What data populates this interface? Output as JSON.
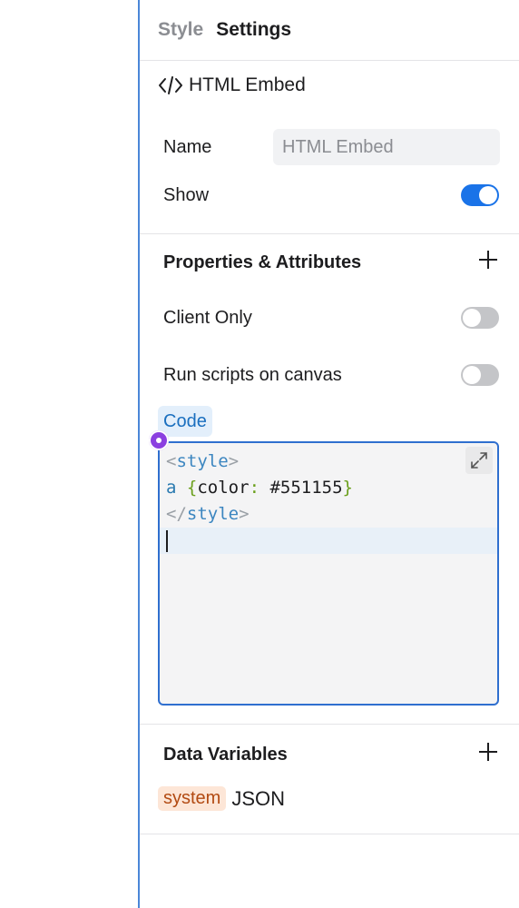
{
  "tabs": {
    "style": "Style",
    "settings": "Settings"
  },
  "component": {
    "icon": "code-icon",
    "title": "HTML Embed"
  },
  "name_field": {
    "label": "Name",
    "placeholder": "HTML Embed"
  },
  "show": {
    "label": "Show",
    "value": true
  },
  "properties": {
    "title": "Properties & Attributes",
    "add_icon": "plus-icon"
  },
  "client_only": {
    "label": "Client Only",
    "value": false
  },
  "run_scripts": {
    "label": "Run scripts on canvas",
    "value": false
  },
  "code": {
    "label": "Code",
    "lines": [
      "<style>",
      "a {color: #551155}",
      "</style>",
      ""
    ],
    "expand_icon": "expand-icon"
  },
  "data_variables": {
    "title": "Data Variables",
    "add_icon": "plus-icon",
    "items": [
      {
        "badge": "system",
        "name": "JSON"
      }
    ]
  },
  "colors": {
    "accent": "#1a73e8",
    "code_border": "#2f6fcf",
    "system_badge_bg": "#fde6d7",
    "system_badge_fg": "#b24a12",
    "code_chip_bg": "#e3effb",
    "dot": "#8b3fe0"
  }
}
